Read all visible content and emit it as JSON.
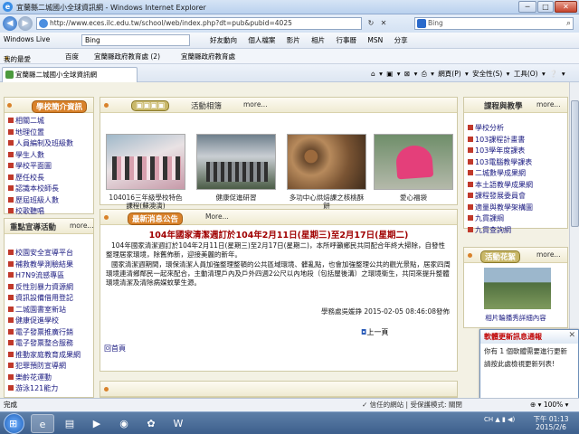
{
  "window": {
    "title": "宜蘭縣二城國小全球資訊網 - Windows Internet Explorer",
    "minimize": "─",
    "maximize": "□",
    "close": "✕"
  },
  "address_bar": {
    "url": "http://www.eces.ilc.edu.tw/school/web/index.php?dt=pub&pubid=4025",
    "refresh": "↻",
    "stop": "✕",
    "search_placeholder": "Bing",
    "search_glyph": "⌕"
  },
  "live_toolbar": {
    "brand": "Windows Live",
    "search_value": "Bing",
    "menu": "好友動向 個人檔案 影片 相片 行事曆 MSN 分享"
  },
  "favorites_bar": {
    "favorites": "我的最愛",
    "baidu": "百度",
    "link1": "宜蘭縣政府教育處 (2)",
    "link2": "宜蘭縣政府教育處"
  },
  "tab": {
    "label": "宜蘭縣二城國小全球資訊網"
  },
  "command_bar": "⌂ ▾ ▣ ▾ ⊠ ▾ ⎙ ▾ 網頁(P) ▾ 安全性(S) ▾ 工具(O) ▾ ❔ ▾",
  "left_panel": {
    "title": "學校簡介資訊",
    "items": [
      "相關二城",
      "地理位置",
      "人員編制及班級數",
      "學生人數",
      "學校平面圖",
      "歷任校長",
      "認識本校師長",
      "歷屆班級人數",
      "校歌聽唱"
    ]
  },
  "left_panel2": {
    "title": "重點宣導活動",
    "more": "more...",
    "items": [
      "校園安全宣導平台",
      "補救教學測驗結果",
      "H7N9流感專區",
      "反性別暴力資源網",
      "資訊設備借用登記",
      "二城園書室新站",
      "健康促進學校",
      "電子發票推廣行銷",
      "電子發票整合服務",
      "推動家庭教育成果網",
      "犯罪預防宣導網",
      "樂齡花運動",
      "游泳121能力"
    ]
  },
  "gallery": {
    "title": "活動相簿",
    "more": "more...",
    "items": [
      {
        "caption": "104016三年級學校特色課程(蘇澳演)"
      },
      {
        "caption": "健康促進研習"
      },
      {
        "caption": "多功中心烘焙課之核桃酥餅"
      },
      {
        "caption": "愛心福袋"
      }
    ]
  },
  "news": {
    "tab": "最新消息公告",
    "more": "More...",
    "headline": "104年國家清潔週訂於104年2月11日(星期三)至2月17日(星期二)",
    "paragraph1": "104年國家清潔週訂於104年2月11日(星期三)至2月17日(星期二)，本所呼籲鄉民共同配合年終大掃除，自發性整理居家環境，除舊佈新，迎接美麗的新年。",
    "paragraph2": "國家清潔週期間，環保清潔人員加強整理整頓的公共區域環境、髒亂點，也會加強整理公共的觀光景點，居家四周環境連清鄉鄰民一起來配合，主動清理戶內及戶外四週2公尺以內地段（包括屋後溝）之環境衛生，共同來提升整體環境清潔及清除病媒蚊孳生源。",
    "meta": "學務處吳媛錚 2015-02-05 08:46:08發佈",
    "prev": "上一頁",
    "home": "回首頁"
  },
  "right_panel": {
    "title": "課程與教學",
    "more": "more...",
    "items": [
      "學校分析",
      "103課程計畫書",
      "103學年度課表",
      "103電腦教學課表",
      "二城數學成果網",
      "本土語教學成果網",
      "課程發展委員會",
      "適量與教學架構圖",
      "九貫課綱",
      "九貫查詢網"
    ]
  },
  "right_panel2": {
    "title": "活動花絮",
    "more": "more...",
    "caption": "相片輪播秀詳細內容"
  },
  "notify": {
    "title": "軟體更新訊息通報",
    "close": "✕",
    "line1": "你有 1 個軟體需要進行更新",
    "line2": "請按此處檢視更新列表!"
  },
  "status": {
    "text": "完成",
    "zone": "✓ 信任的網站 | 受保護模式: 關閉",
    "zoom": "⊕ ▾ 100% ▾"
  },
  "taskbar": {
    "tray": "CH ▲ ▮ ◀)",
    "time": "下午 01:13",
    "date": "2015/2/6",
    "start": "⊞",
    "apps": {
      "ie": "e",
      "explorer": "▤",
      "media": "▶",
      "chrome": "◉",
      "green": "✿",
      "word": "W"
    }
  },
  "colors": {
    "accent": "#d9822b",
    "headline": "#a00000",
    "link": "#1a1a80",
    "content_bg": "#f3f1e4"
  }
}
